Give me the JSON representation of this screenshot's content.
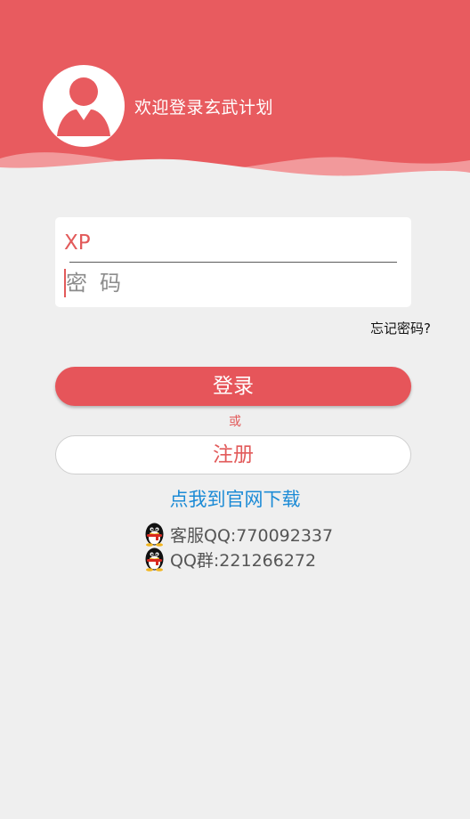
{
  "header": {
    "welcome_text": "欢迎登录玄武计划",
    "bg_color": "#e85b5f",
    "avatar_icon": "user-avatar-icon"
  },
  "login_form": {
    "username_value": "XP",
    "password_placeholder": "密码"
  },
  "links": {
    "forgot_password": "忘记密码?"
  },
  "buttons": {
    "login_label": "登录",
    "or_label": "或",
    "register_label": "注册"
  },
  "download": {
    "label": "点我到官网下载"
  },
  "contacts": [
    {
      "icon": "qq-penguin-icon",
      "text": "客服QQ:770092337"
    },
    {
      "icon": "qq-penguin-icon",
      "text": "QQ群:221266272"
    }
  ],
  "colors": {
    "accent": "#e6555a",
    "link": "#1c8bd6",
    "background": "#efefef"
  }
}
